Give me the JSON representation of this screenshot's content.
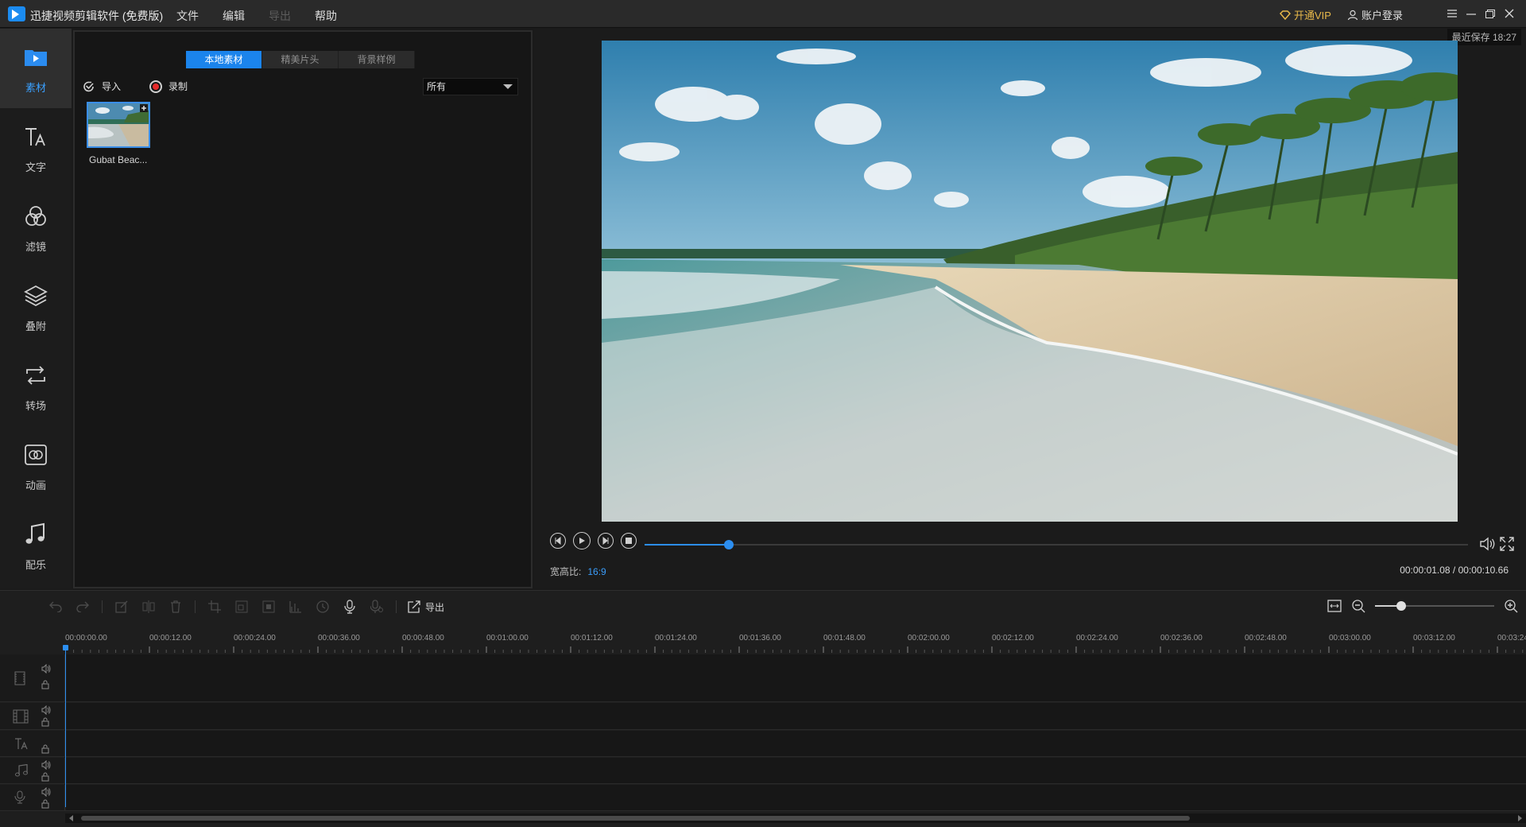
{
  "app": {
    "title": "迅捷视频剪辑软件 (免费版)",
    "menu": [
      {
        "label": "文件",
        "enabled": true
      },
      {
        "label": "编辑",
        "enabled": true
      },
      {
        "label": "导出",
        "enabled": false
      },
      {
        "label": "帮助",
        "enabled": true
      }
    ],
    "vip_label": "开通VIP",
    "login_label": "账户登录"
  },
  "sidebar": {
    "items": [
      {
        "label": "素材",
        "icon": "folder-play-icon",
        "active": true
      },
      {
        "label": "文字",
        "icon": "text-icon",
        "active": false
      },
      {
        "label": "滤镜",
        "icon": "filter-icon",
        "active": false
      },
      {
        "label": "叠附",
        "icon": "overlay-layers-icon",
        "active": false
      },
      {
        "label": "转场",
        "icon": "transition-icon",
        "active": false
      },
      {
        "label": "动画",
        "icon": "animation-icon",
        "active": false
      },
      {
        "label": "配乐",
        "icon": "music-icon",
        "active": false
      }
    ]
  },
  "media": {
    "tabs": [
      "本地素材",
      "精美片头",
      "背景样例"
    ],
    "active_tab": 0,
    "import_label": "导入",
    "record_label": "录制",
    "filter_value": "所有",
    "items": [
      {
        "name": "Gubat Beac..."
      }
    ]
  },
  "preview": {
    "last_saved": "最近保存 18:27",
    "aspect_label": "宽高比:",
    "aspect_value": "16:9",
    "timecode": "00:00:01.08 / 00:00:10.66",
    "progress_fraction": 0.102
  },
  "timeline": {
    "export_label": "导出",
    "zoom_fraction": 0.22,
    "ruler_labels": [
      "00:00:00.00",
      "00:00:12.00",
      "00:00:24.00",
      "00:00:36.00",
      "00:00:48.00",
      "00:01:00.00",
      "00:01:12.00",
      "00:01:24.00",
      "00:01:36.00",
      "00:01:48.00",
      "00:02:00.00",
      "00:02:12.00",
      "00:02:24.00",
      "00:02:36.00",
      "00:02:48.00",
      "00:03:00.00",
      "00:03:12.00",
      "00:03:24"
    ],
    "tracks": [
      "video-main",
      "video-overlay",
      "text",
      "music",
      "voice"
    ]
  },
  "colors": {
    "accent": "#1b84ec",
    "vip": "#e8b94a",
    "record": "#e52a2a"
  }
}
